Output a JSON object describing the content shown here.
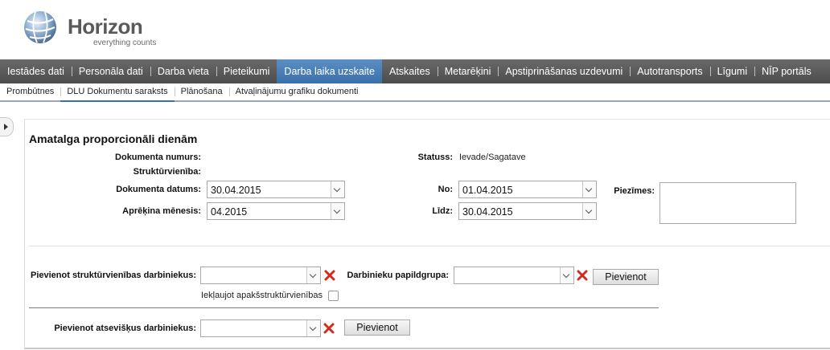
{
  "brand": {
    "name": "Horizon",
    "tagline": "everything counts"
  },
  "mainnav": [
    {
      "label": "Iestādes dati"
    },
    {
      "label": "Personāla dati"
    },
    {
      "label": "Darba vieta"
    },
    {
      "label": "Pieteikumi"
    },
    {
      "label": "Darba laika uzskaite",
      "active": true
    },
    {
      "label": "Atskaites"
    },
    {
      "label": "Metarēķini"
    },
    {
      "label": "Apstiprināšanas uzdevumi"
    },
    {
      "label": "Autotransports"
    },
    {
      "label": "Līgumi"
    },
    {
      "label": "NĪP portāls"
    }
  ],
  "subnav": [
    {
      "label": "Prombūtnes"
    },
    {
      "label": "DLU Dokumentu saraksts",
      "active": true
    },
    {
      "label": "Plānošana"
    },
    {
      "label": "Atvaļinājumu grafiku dokumenti"
    }
  ],
  "form": {
    "title": "Amatalga proporcionāli dienām",
    "doc_number_label": "Dokumenta numurs:",
    "struct_label": "Struktūrvienība:",
    "doc_date_label": "Dokumenta datums:",
    "doc_date_value": "30.04.2015",
    "calc_month_label": "Aprēķina mēnesis:",
    "calc_month_value": "04.2015",
    "status_label": "Statuss:",
    "status_value": "Ievade/Sagatave",
    "from_label": "No:",
    "from_value": "01.04.2015",
    "to_label": "Līdz:",
    "to_value": "30.04.2015",
    "notes_label": "Piezīmes:"
  },
  "add": {
    "struct_employees_label": "Pievienot struktūrvienības darbiniekus:",
    "subgroup_label": "Darbinieku papildgrupa:",
    "add_button": "Pievienot",
    "include_sub_label": "Iekļaujot apakšstruktūrvienības",
    "single_employees_label": "Pievienot atsevišķus darbiniekus:",
    "add_button2": "Pievienot"
  },
  "colors": {
    "nav_active": "#3a6fa8",
    "nav_bg": "#555555",
    "delete_icon": "#d42a1e"
  }
}
